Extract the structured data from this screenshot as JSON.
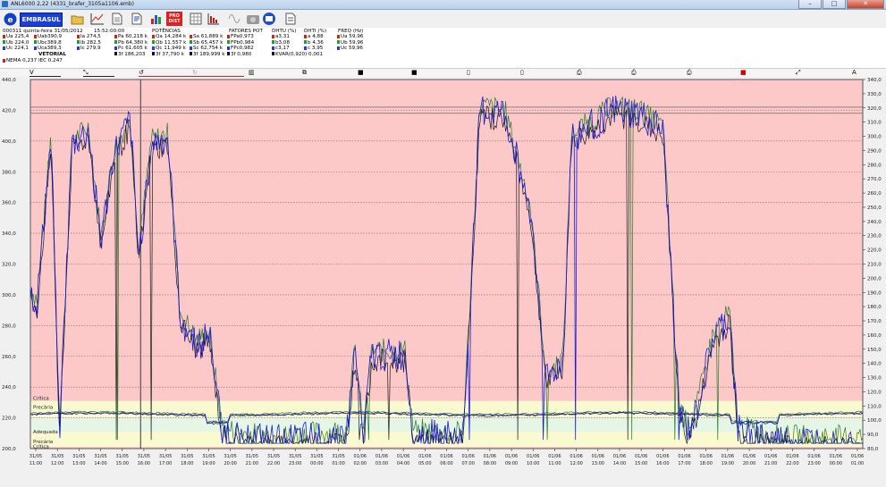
{
  "window": {
    "title": "ANL6000 2,22 (4331_brafer_3105a1106.emb)",
    "min": "–",
    "max": "□",
    "close": "✕"
  },
  "toolbar": {
    "brand": "EMBRASUL",
    "pro_label": "PRO DIST"
  },
  "info": {
    "id": "000311",
    "date": "quinta-feira 31/05/2012",
    "time": "15:52:00:00",
    "col1": [
      "Ua 225,4",
      "Ub 224,0",
      "Uc 224,1"
    ],
    "col2": [
      "Uab390,9",
      "Ubc389,8",
      "Uca389,3",
      "VETORIAL"
    ],
    "col3": [
      "Ia 274,5",
      "Ib 282,5",
      "Ic 279,9"
    ],
    "pot_title": "POTÊNCIAS",
    "col4": [
      "Pa 60,218 k",
      "Pb 64,380 k",
      "Pc 61,605 k",
      "3f 186,203"
    ],
    "col5": [
      "Qa 14,284 k",
      "Qb 11,557 k",
      "Qc 11,949 k",
      "3f 37,790 k"
    ],
    "col6": [
      "Sa 61,889 k",
      "Sb 65,457 k",
      "Sc 62,754 k",
      "3f 189,999 k"
    ],
    "fp_title": "FATORES POT",
    "col7": [
      "FPa0,973",
      "FPb0,984",
      "FPc0,982",
      "3f 0,980"
    ],
    "dhtu_title": "DHTU (%)",
    "col8": [
      "a3,31",
      "b3,08",
      "c3,17",
      "KVAR(0,920) 0,001"
    ],
    "dhti_title": "DHTI (%)",
    "col9": [
      "a 4,88",
      "b 4,36",
      "c 3,95"
    ],
    "freq_title": "FREQ (Hz)",
    "col10": [
      "Ua 59,96",
      "Ub 59,96",
      "Uc 59,96"
    ],
    "nema": "NEMA  0,237 IEC  0,247"
  },
  "tabs": {
    "left": "V",
    "right": "A"
  },
  "chart_data": {
    "type": "line",
    "y_left_ticks": [
      "440,0",
      "420,0",
      "400,0",
      "380,0",
      "360,0",
      "340,0",
      "320,0",
      "300,0",
      "280,0",
      "260,0",
      "240,0",
      "220,0",
      "200,0"
    ],
    "y_left_range": [
      200,
      440
    ],
    "y_right_ticks": [
      "340,0",
      "330,0",
      "320,0",
      "310,0",
      "300,0",
      "290,0",
      "280,0",
      "270,0",
      "260,0",
      "250,0",
      "240,0",
      "230,0",
      "220,0",
      "210,0",
      "200,0",
      "190,0",
      "180,0",
      "170,0",
      "160,0",
      "150,0",
      "140,0",
      "130,0",
      "120,0",
      "110,0",
      "100,0",
      "90,0",
      "80,0"
    ],
    "y_right_range": [
      80,
      340
    ],
    "x_dates": [
      "31/05",
      "31/05",
      "31/05",
      "31/05",
      "31/05",
      "31/05",
      "31/05",
      "31/05",
      "31/05",
      "31/05",
      "31/05",
      "31/05",
      "31/05",
      "31/05",
      "31/05",
      "01/06",
      "01/06",
      "01/06",
      "01/06",
      "01/06",
      "01/06",
      "01/06",
      "01/06",
      "01/06",
      "01/06",
      "01/06",
      "01/06",
      "01/06",
      "01/06",
      "01/06",
      "01/06",
      "01/06",
      "01/06",
      "01/06",
      "01/06",
      "01/06",
      "01/06",
      "01/06",
      "01/06",
      "02/06"
    ],
    "x_times": [
      "11:00",
      "12:00",
      "13:00",
      "14:00",
      "15:00",
      "16:00",
      "17:00",
      "18:00",
      "19:00",
      "20:00",
      "21:00",
      "22:00",
      "23:00",
      "00:00",
      "01:00",
      "02:00",
      "03:00",
      "04:00",
      "05:00",
      "06:00",
      "07:00",
      "08:00",
      "09:00",
      "10:00",
      "11:00",
      "12:00",
      "13:00",
      "14:00",
      "15:00",
      "16:00",
      "17:00",
      "18:00",
      "19:00",
      "20:00",
      "21:00",
      "22:00",
      "23:00",
      "00:00",
      "01:00"
    ],
    "zone_labels": {
      "critica_top": "Crítica",
      "precaria_top": "Precária",
      "adequada": "Adequada",
      "precaria_bottom": "Precária",
      "critica_bottom": "Crítica"
    },
    "colors": {
      "critical": "#fcc8c8",
      "adequate": "#e6f6e6",
      "precarious": "#fafad0",
      "phase_a": "#2a7a2a",
      "phase_b": "#1a1a1a",
      "phase_c": "#1a1ad8"
    }
  }
}
